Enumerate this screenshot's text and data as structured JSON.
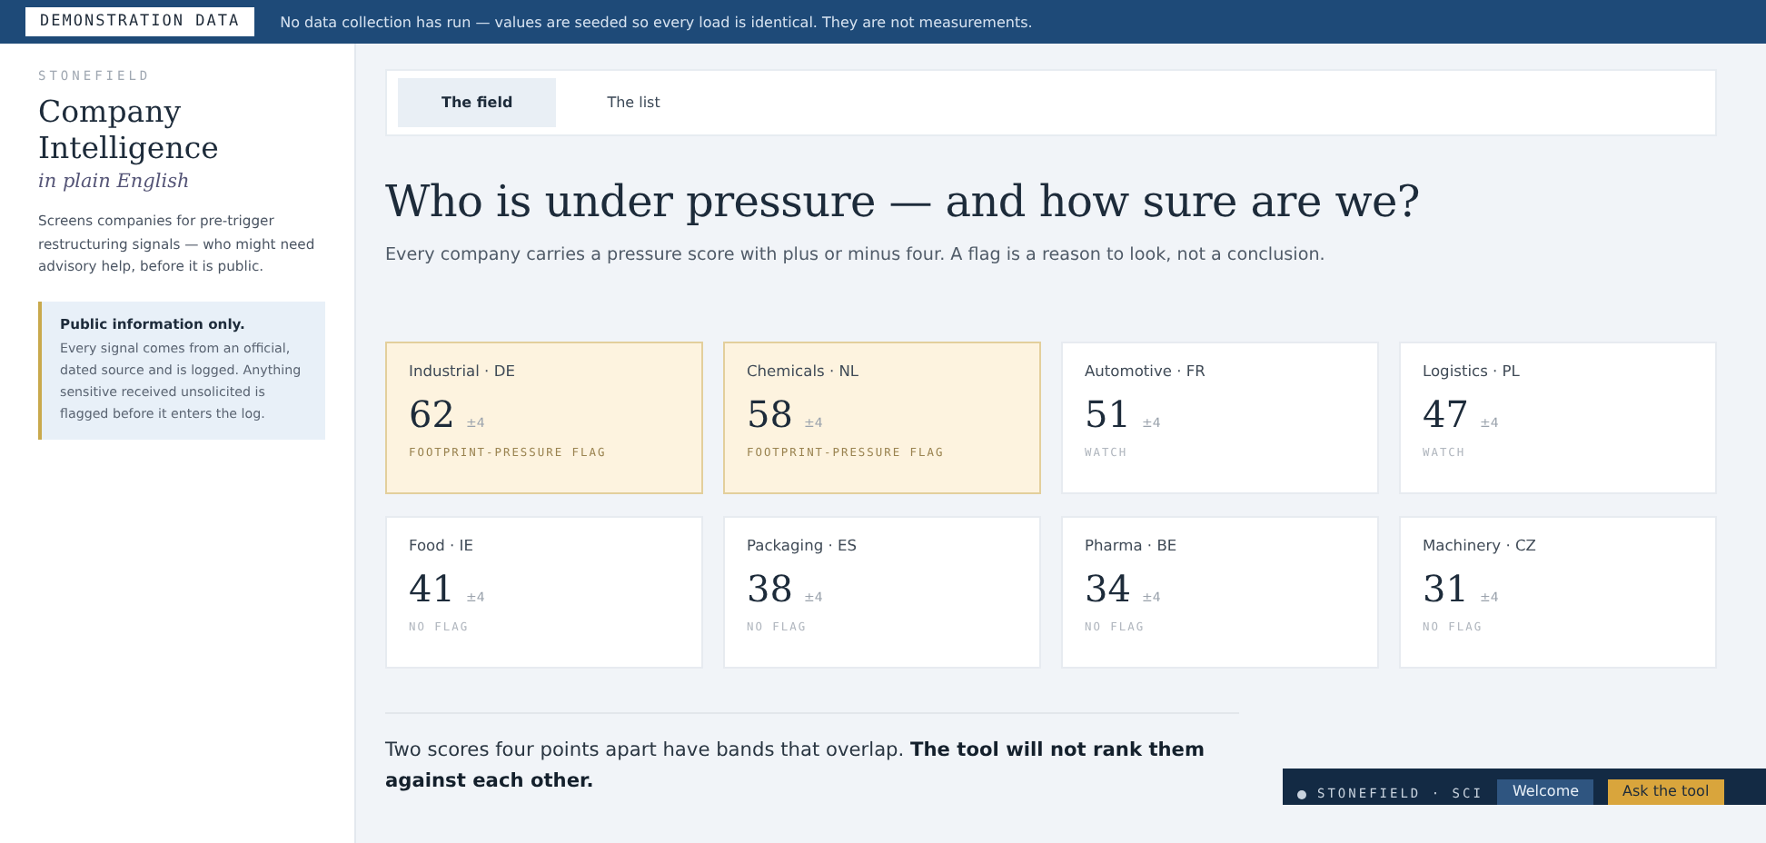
{
  "banner": {
    "badge": "DEMONSTRATION DATA",
    "notice": "No data collection has run — values are seeded so every load is identical. They are not measurements."
  },
  "sidebar": {
    "eyebrow": "STONEFIELD",
    "title": "Company Intelligence",
    "subtitle": "in plain English",
    "description": "Screens companies for pre-trigger restructuring signals — who might need advisory help, before it is public.",
    "callout": {
      "heading": "Public information only.",
      "body": "Every signal comes from an official, dated source and is logged. Anything sensitive received unsolicited is flagged before it enters the log."
    }
  },
  "tabs": [
    {
      "label": "The field",
      "selected": true
    },
    {
      "label": "The list",
      "selected": false
    }
  ],
  "heading": "Who is under pressure — and how sure are we?",
  "intro": "Every company carries a pressure score with plus or minus four. A flag is a reason to look, not a conclusion.",
  "cards": [
    {
      "name": "Industrial · DE",
      "score": "62",
      "band": "±4",
      "status": "FOOTPRINT-PRESSURE FLAG",
      "kind": "flag"
    },
    {
      "name": "Chemicals · NL",
      "score": "58",
      "band": "±4",
      "status": "FOOTPRINT-PRESSURE FLAG",
      "kind": "flag"
    },
    {
      "name": "Automotive · FR",
      "score": "51",
      "band": "±4",
      "status": "WATCH",
      "kind": "watch"
    },
    {
      "name": "Logistics · PL",
      "score": "47",
      "band": "±4",
      "status": "WATCH",
      "kind": "watch"
    },
    {
      "name": "Food · IE",
      "score": "41",
      "band": "±4",
      "status": "NO FLAG",
      "kind": "none"
    },
    {
      "name": "Packaging · ES",
      "score": "38",
      "band": "±4",
      "status": "NO FLAG",
      "kind": "none"
    },
    {
      "name": "Pharma · BE",
      "score": "34",
      "band": "±4",
      "status": "NO FLAG",
      "kind": "none"
    },
    {
      "name": "Machinery · CZ",
      "score": "31",
      "band": "±4",
      "status": "NO FLAG",
      "kind": "none"
    }
  ],
  "note": "Two scores four points apart have bands that overlap. **The tool will not rank them against each other.**",
  "dock": {
    "brand": "STONEFIELD · SCI",
    "buttons": [
      {
        "label": "Welcome",
        "kind": "secondary"
      },
      {
        "label": "Ask the tool",
        "kind": "primary"
      }
    ]
  }
}
